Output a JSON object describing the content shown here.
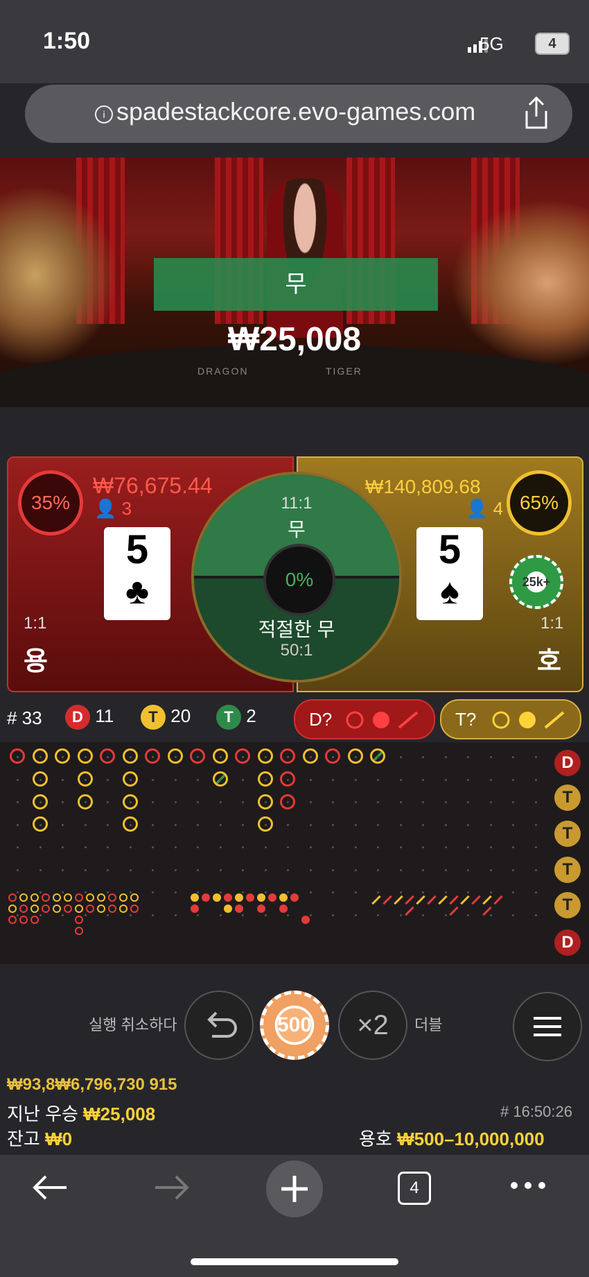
{
  "status": {
    "time": "1:50",
    "network": "5G",
    "battery": "4"
  },
  "browser": {
    "url": "spadestackcore.evo-games.com",
    "info_icon": "info-icon",
    "share_icon": "share-icon"
  },
  "video": {
    "result_label": "무",
    "result_amount": "₩25,008",
    "table_left": "DRAGON",
    "table_right": "TIGER"
  },
  "dragon": {
    "percent": "35%",
    "amount": "₩76,675.44",
    "players": "3",
    "card_rank": "5",
    "card_suit": "♣",
    "odds": "1:1",
    "label": "용",
    "color": "#c43030"
  },
  "tiger": {
    "percent": "65%",
    "amount": "₩140,809.68",
    "players": "4",
    "card_rank": "5",
    "card_suit": "♠",
    "odds": "1:1",
    "label": "호",
    "chip": "25k+",
    "color": "#d8b040"
  },
  "tie": {
    "odds": "11:1",
    "label": "무",
    "percent": "0%",
    "suited_label": "적절한 무",
    "suited_odds": "50:1"
  },
  "stats": {
    "round": "# 33",
    "dragon_badge": "D",
    "dragon_count": "11",
    "tiger_badge": "T",
    "tiger_count": "20",
    "tie_badge": "T",
    "tie_count": "2",
    "dragon_ask": "D?",
    "tiger_ask": "T?"
  },
  "side_badges": [
    "D",
    "T",
    "T",
    "T",
    "T",
    "D"
  ],
  "controls": {
    "undo_label": "실행 취소하다",
    "chip_value": "500",
    "double_symbol": "×2",
    "double_label": "더블"
  },
  "info": {
    "overlap_text": "₩93,8₩6,796,730 915",
    "last_win_label": "지난 우승",
    "last_win_value": "₩25,008",
    "balance_label": "잔고",
    "balance_value": "₩0",
    "time": "# 16:50:26",
    "limits_label": "용호",
    "limits_value": "₩500–10,000,000"
  },
  "nav": {
    "tabs": "4"
  }
}
